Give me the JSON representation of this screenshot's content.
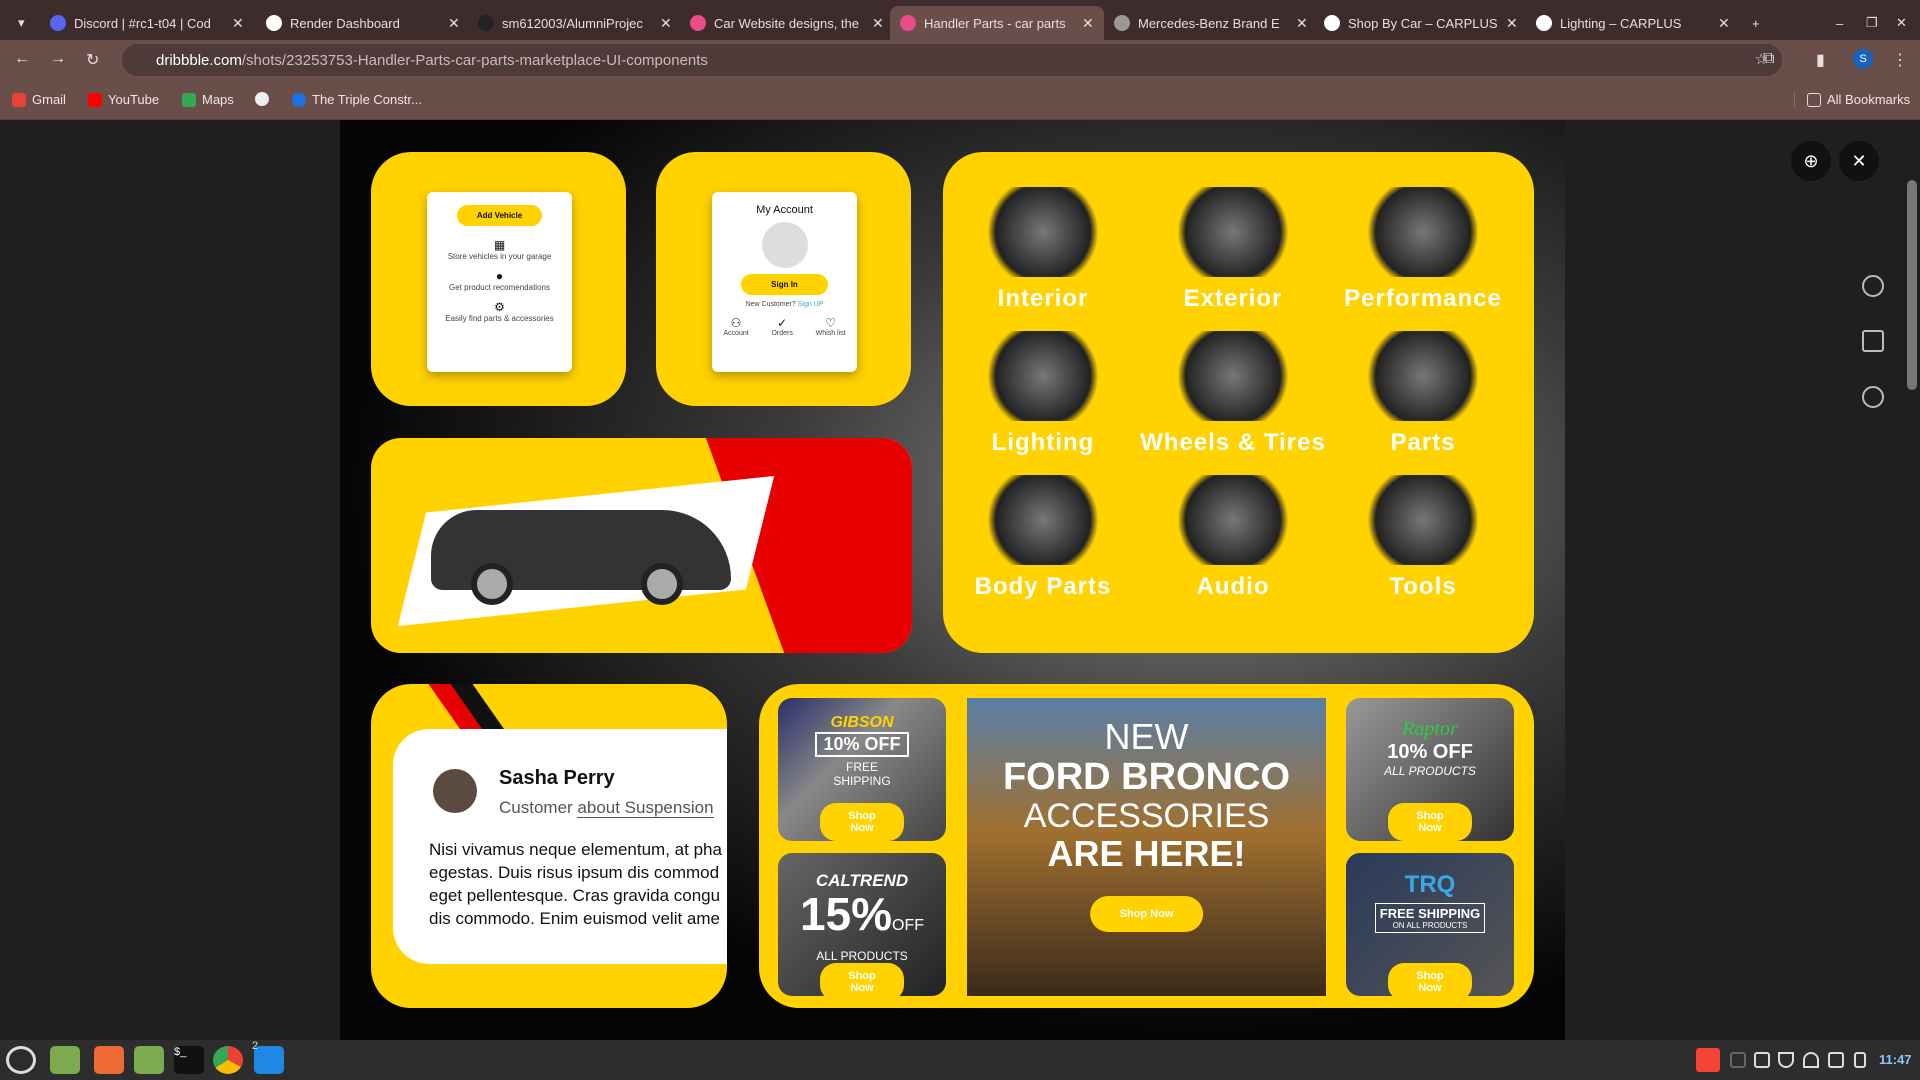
{
  "browser": {
    "tabs": [
      {
        "title": "Discord | #rc1-t04 | Cod",
        "color": "#5865f2"
      },
      {
        "title": "Render Dashboard",
        "color": "#ffffff"
      },
      {
        "title": "sm612003/AlumniProjec",
        "color": "#222222"
      },
      {
        "title": "Car Website designs, the",
        "color": "#ea4c89"
      },
      {
        "title": "Handler Parts - car parts",
        "color": "#ea4c89",
        "active": true
      },
      {
        "title": "Mercedes-Benz Brand E",
        "color": "#999999"
      },
      {
        "title": "Shop By Car – CARPLUS",
        "color": "#ffffff"
      },
      {
        "title": "Lighting – CARPLUS",
        "color": "#ffffff"
      }
    ],
    "url_domain": "dribbble.com",
    "url_path": "/shots/23253753-Handler-Parts-car-parts-marketplace-UI-components",
    "bookmarks": [
      "Gmail",
      "YouTube",
      "Maps",
      "",
      "The Triple Constr..."
    ],
    "all_bookmarks": "All Bookmarks",
    "profile_initial": "S"
  },
  "shot": {
    "garage": {
      "button": "Add Vehicle",
      "items": [
        "Store vehicles in your garage",
        "Get product recomendations",
        "Easily find parts & accessories"
      ]
    },
    "account": {
      "title": "My Account",
      "button": "Sign In",
      "new_customer": "New Customer?",
      "sign_up": "Sign UP",
      "links": [
        "Account",
        "Orders",
        "Whish list"
      ]
    },
    "categories": [
      "Interior",
      "Exterior",
      "Performance",
      "Lighting",
      "Wheels & Tires",
      "Parts",
      "Body Parts",
      "Audio",
      "Tools"
    ],
    "testimonial": {
      "name": "Sasha Perry",
      "role": "Customer",
      "about": "about Suspension",
      "text": "Nisi vivamus neque elementum, at pha egestas. Duis risus ipsum dis commod eget pellentesque. Cras gravida congu dis commodo. Enim euismod velit ame"
    },
    "promos": {
      "gibson": {
        "brand": "GIBSON",
        "offer": "10% OFF",
        "sub": "FREE SHIPPING",
        "cta": "Shop Now"
      },
      "caltrend": {
        "brand": "CALTREND",
        "offer": "15%",
        "off": "OFF",
        "sub": "ALL PRODUCTS",
        "cta": "Shop Now"
      },
      "bronco": {
        "l1": "NEW",
        "l2": "FORD BRONCO",
        "l3": "ACCESSORIES",
        "l4": "ARE HERE!",
        "cta": "Shop Now"
      },
      "raptor": {
        "brand": "Raptor",
        "offer": "10% OFF",
        "sub": "ALL PRODUCTS",
        "cta": "Shop Now"
      },
      "trq": {
        "brand": "TRQ",
        "offer": "FREE SHIPPING",
        "sub": "ON ALL PRODUCTS",
        "cta": "Shop Now"
      }
    },
    "accent": "#ffd200"
  },
  "taskbar": {
    "clock": "11:47",
    "badge": "2"
  }
}
